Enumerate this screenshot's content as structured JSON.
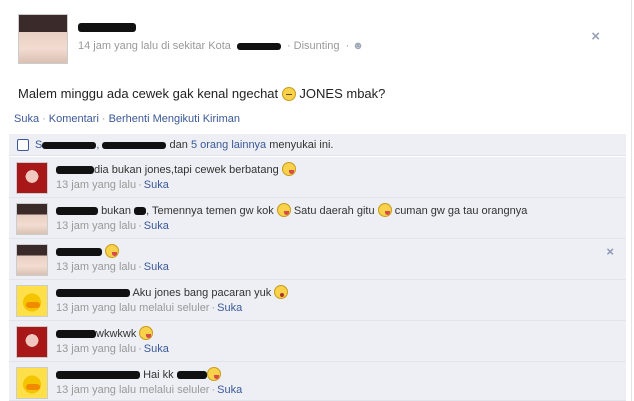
{
  "post": {
    "timestamp": "14 jam yang lalu di sekitar Kota",
    "edited": "Disunting",
    "body_text": "Malem minggu ada cewek gak kenal ngechat",
    "body_tail": "JONES mbak?",
    "close_glyph": "×"
  },
  "actions": {
    "like": "Suka",
    "comment": "Komentari",
    "unfollow": "Berhenti Mengikuti Kiriman"
  },
  "likes": {
    "prefix": "S",
    "dan": "dan",
    "others": "5 orang lainnya",
    "suffix": "menyukai ini."
  },
  "comments": [
    {
      "text": "dia bukan jones,tapi cewek berbatang",
      "time": "13 jam yang lalu",
      "like": "Suka",
      "avatar": "red-hair"
    },
    {
      "text_a": "bukan",
      "text_b": ", Temennya temen gw kok",
      "text_c": "Satu daerah gitu",
      "text_d": "cuman gw ga tau orangnya",
      "time": "13 jam yang lalu",
      "like": "Suka",
      "avatar": "girl"
    },
    {
      "time": "13 jam yang lalu",
      "like": "Suka",
      "avatar": "girl",
      "close": "×"
    },
    {
      "text": "Aku jones bang pacaran yuk",
      "time": "13 jam yang lalu melalui seluler",
      "like": "Suka",
      "avatar": "duck"
    },
    {
      "text": "wkwkwk",
      "time": "13 jam yang lalu",
      "like": "Suka",
      "avatar": "red-hair"
    },
    {
      "text": "Hai kk",
      "time": "13 jam yang lalu melalui seluler",
      "like": "Suka",
      "avatar": "duck"
    }
  ],
  "colors": {
    "link": "#3b5998",
    "comment_bg": "#edeff4",
    "meta": "#999999"
  },
  "icons": [
    "close-icon",
    "friends-icon",
    "thumbs-up-icon",
    "sad-emoticon",
    "tongue-emoticon",
    "surprised-emoticon"
  ]
}
